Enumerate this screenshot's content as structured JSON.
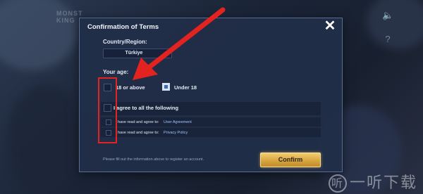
{
  "background": {
    "logo_line1": "MONST",
    "logo_line2": "KING"
  },
  "dialog": {
    "title": "Confirmation of Terms",
    "close_icon": "close-icon",
    "country_label": "Country/Region:",
    "country_value": "Türkiye",
    "age_label": "Your age:",
    "age_options": [
      {
        "label": "18 or above",
        "checked": false
      },
      {
        "label": "Under 18",
        "checked": true
      }
    ],
    "agree_all_label": "I agree to all the following",
    "agreements": [
      {
        "prefix": "I have read and agree to:",
        "link": "User Agreement"
      },
      {
        "prefix": "I have read and agree to:",
        "link": "Privacy Policy"
      }
    ],
    "footer_note": "Please fill out the information above to register an account.",
    "confirm_label": "Confirm"
  },
  "annotation": {
    "color": "#e2231f"
  },
  "watermark": {
    "text": "一听下载",
    "mark": "听"
  },
  "colors": {
    "dialog_bg": "#212e48",
    "confirm_gold": "#d8a640",
    "link_blue": "#9fc3ff"
  }
}
